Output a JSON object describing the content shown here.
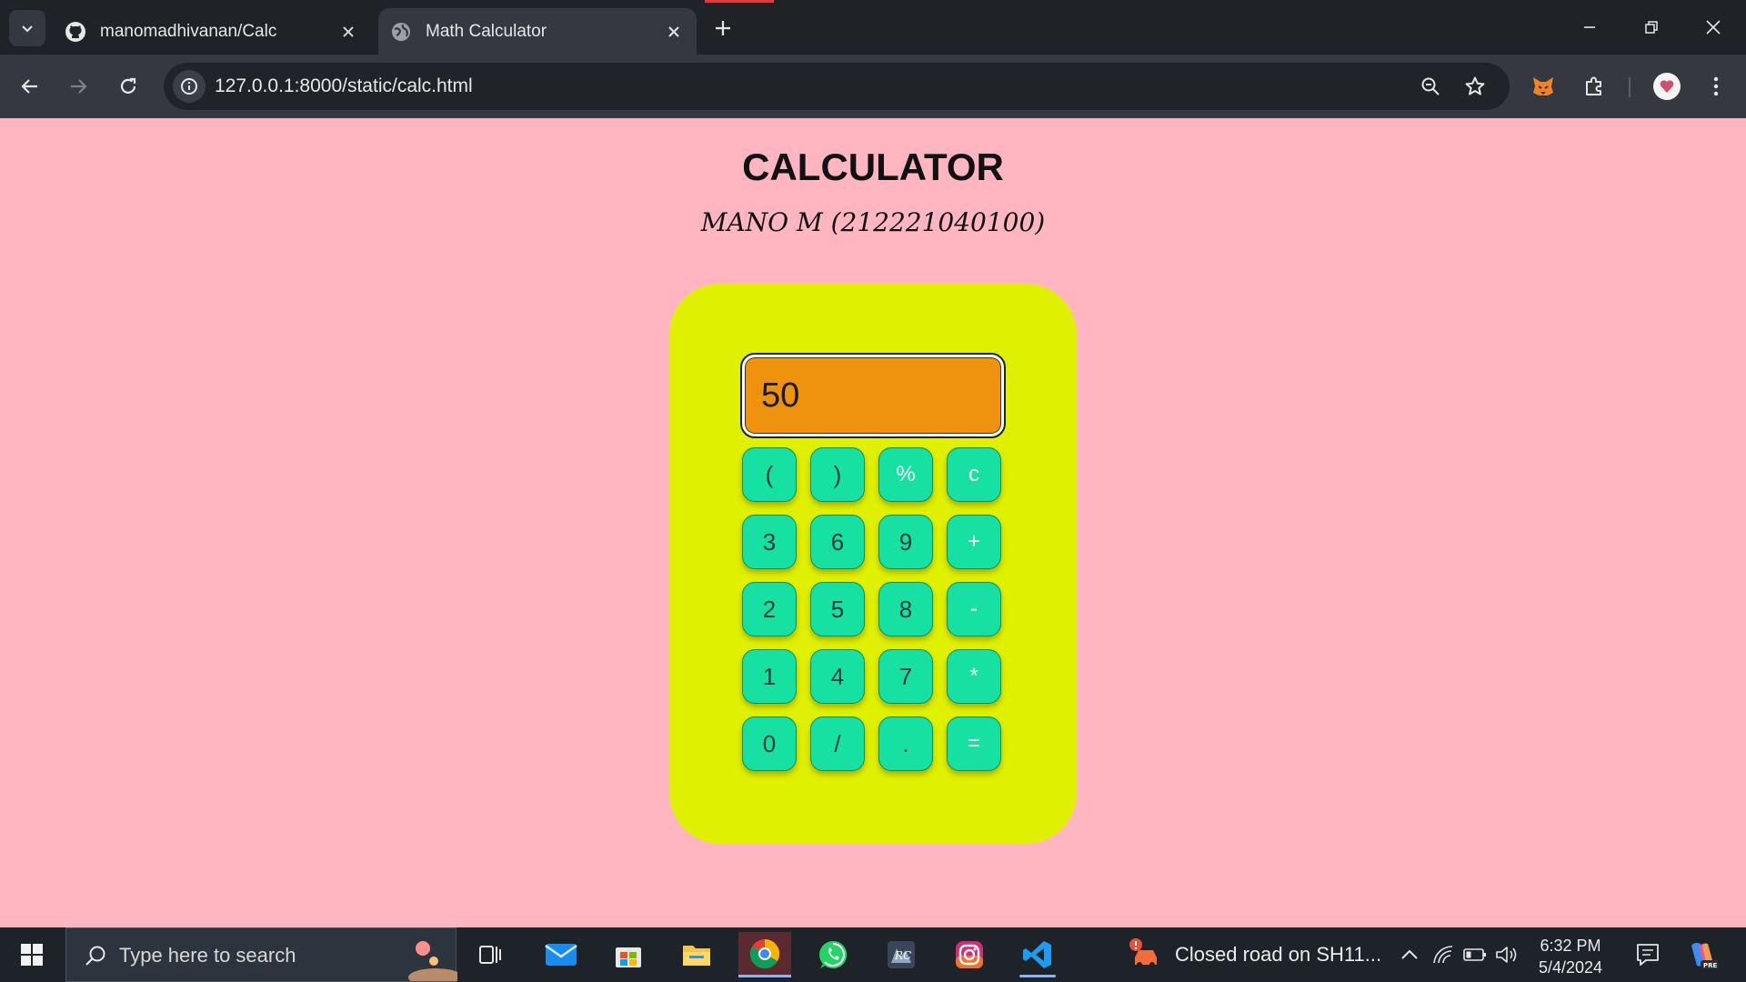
{
  "browser": {
    "tabs": [
      {
        "title": "manomadhivanan/Calc",
        "icon": "github-icon",
        "active": false
      },
      {
        "title": "Math Calculator",
        "icon": "globe-icon",
        "active": true
      }
    ],
    "url": "127.0.0.1:8000/static/calc.html"
  },
  "page": {
    "heading": "CALCULATOR",
    "author": "MANO M (212221040100)",
    "background_color": "#ffb6c1",
    "calculator": {
      "body_color": "#dff000",
      "display_color": "#ef920d",
      "key_color": "#16e0a2",
      "display_value": "50",
      "keys": [
        [
          "(",
          ")",
          "%",
          "c"
        ],
        [
          "3",
          "6",
          "9",
          "+"
        ],
        [
          "2",
          "5",
          "8",
          "-"
        ],
        [
          "1",
          "4",
          "7",
          "*"
        ],
        [
          "0",
          "/",
          ".",
          "="
        ]
      ]
    }
  },
  "taskbar": {
    "search_placeholder": "Type here to search",
    "apps": [
      "task-view-icon",
      "mail-icon",
      "store-icon",
      "file-explorer-icon",
      "chrome-icon",
      "whatsapp-icon",
      "photo-app-icon",
      "instagram-icon",
      "vscode-icon"
    ],
    "news": "Closed road on SH11...",
    "time": "6:32 PM",
    "date": "5/4/2024"
  }
}
